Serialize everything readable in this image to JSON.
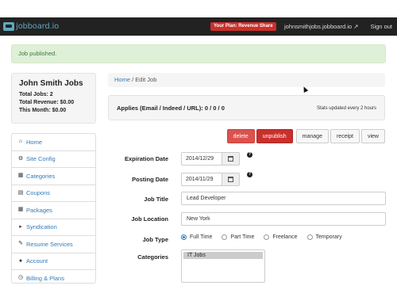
{
  "header": {
    "logo_text": "jobboard.io",
    "plan_badge": "Your Plan: Revenue Share",
    "site_link": "johnsmithjobs.jobboard.io",
    "signout": "Sign out"
  },
  "alert": {
    "message": "Job published."
  },
  "stats": {
    "name": "John Smith Jobs",
    "total_jobs": "Total Jobs: 2",
    "total_revenue": "Total Revenue: $0.00",
    "this_month": "This Month: $0.00"
  },
  "sidebar": {
    "items": [
      {
        "label": "Home",
        "icon": "home-icon"
      },
      {
        "label": "Site Config",
        "icon": "gear-icon"
      },
      {
        "label": "Categories",
        "icon": "folder-icon"
      },
      {
        "label": "Coupons",
        "icon": "cart-icon"
      },
      {
        "label": "Packages",
        "icon": "grid-icon"
      },
      {
        "label": "Syndication",
        "icon": "megaphone-icon"
      },
      {
        "label": "Resume Services",
        "icon": "pencil-icon"
      },
      {
        "label": "Account",
        "icon": "user-icon"
      },
      {
        "label": "Billing & Plans",
        "icon": "clock-icon"
      }
    ]
  },
  "breadcrumb": {
    "home": "Home",
    "current": "/ Edit Job"
  },
  "applies": {
    "label": "Applies (Email / Indeed / URL): 0 / 0 / 0",
    "note": "Stats updated every 2 hours"
  },
  "actions": {
    "delete": "delete",
    "unpublish": "unpublish",
    "manage": "manage",
    "receipt": "receipt",
    "view": "view"
  },
  "form": {
    "expiration_label": "Expiration Date",
    "expiration_value": "2014/12/29",
    "posting_label": "Posting Date",
    "posting_value": "2014/11/29",
    "title_label": "Job Title",
    "title_value": "Lead Developer",
    "location_label": "Job Location",
    "location_value": "New York",
    "type_label": "Job Type",
    "type_options": [
      "Full Time",
      "Part Time",
      "Freelance",
      "Temporary"
    ],
    "type_selected": "Full Time",
    "categories_label": "Categories",
    "categories_selected": "IT Jobs"
  },
  "colors": {
    "topbar": "#222222",
    "brand": "#5fa8bd",
    "danger": "#d9534f",
    "success_bg": "#dff0d8",
    "link": "#337ab7"
  }
}
